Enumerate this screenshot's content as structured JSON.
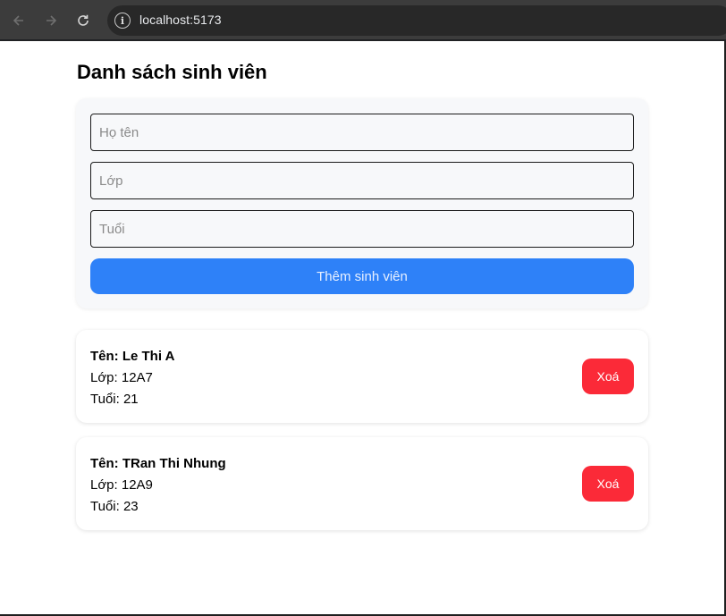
{
  "browser": {
    "url": "localhost:5173",
    "info_glyph": "i"
  },
  "page": {
    "title": "Danh sách sinh viên"
  },
  "form": {
    "name_placeholder": "Họ tên",
    "class_placeholder": "Lớp",
    "age_placeholder": "Tuổi",
    "submit_label": "Thêm sinh viên"
  },
  "students": [
    {
      "name_line": "Tên: Le Thi A",
      "class_line": "Lớp: 12A7",
      "age_line": "Tuổi: 21",
      "delete_label": "Xoá"
    },
    {
      "name_line": "Tên: TRan Thi Nhung",
      "class_line": "Lớp: 12A9",
      "age_line": "Tuổi: 23",
      "delete_label": "Xoá"
    }
  ],
  "colors": {
    "primary": "#2e81f8",
    "danger": "#fb2a38",
    "card_bg": "#f7f8fa"
  }
}
